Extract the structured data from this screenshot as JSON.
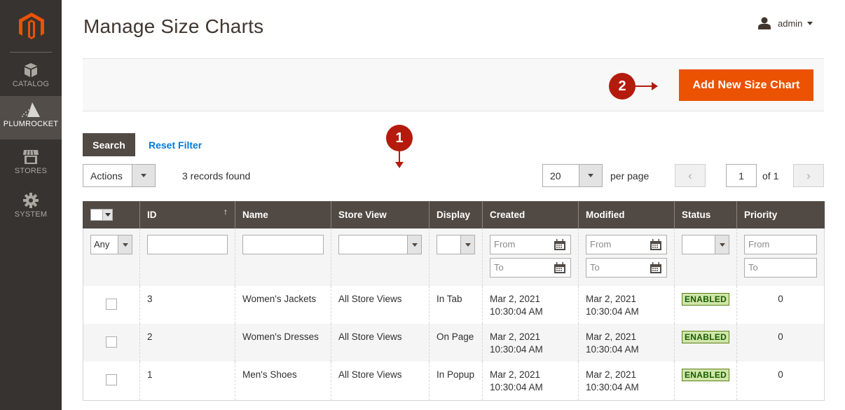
{
  "sidebar": {
    "logo": "magento-logo",
    "items": [
      {
        "label": "CATALOG",
        "icon": "box-icon",
        "active": false
      },
      {
        "label": "PLUMROCKET",
        "icon": "plumrocket-icon",
        "active": true
      },
      {
        "label": "STORES",
        "icon": "storefront-icon",
        "active": false
      },
      {
        "label": "SYSTEM",
        "icon": "gear-icon",
        "active": false
      }
    ]
  },
  "header": {
    "title": "Manage Size Charts",
    "user": "admin"
  },
  "action_bar": {
    "add_button": "Add New Size Chart"
  },
  "callouts": {
    "one": "1",
    "two": "2"
  },
  "grid_controls": {
    "search_button": "Search",
    "reset_filter": "Reset Filter",
    "actions_select": "Actions",
    "records_found": "3 records found",
    "per_page_value": "20",
    "per_page_label": "per page",
    "current_page": "1",
    "page_of": "of 1",
    "prev_icon": "‹",
    "next_icon": "›"
  },
  "columns": [
    "",
    "ID",
    "Name",
    "Store View",
    "Display",
    "Created",
    "Modified",
    "Status",
    "Priority"
  ],
  "sort_indicator": "↑",
  "filters": {
    "select_any": "Any",
    "from_placeholder": "From",
    "to_placeholder": "To"
  },
  "rows": [
    {
      "id": "3",
      "name": "Women's Jackets",
      "store_view": "All Store Views",
      "display": "In Tab",
      "created_date": "Mar 2, 2021",
      "created_time": "10:30:04 AM",
      "modified_date": "Mar 2, 2021",
      "modified_time": "10:30:04 AM",
      "status": "ENABLED",
      "priority": "0"
    },
    {
      "id": "2",
      "name": "Women's Dresses",
      "store_view": "All Store Views",
      "display": "On Page",
      "created_date": "Mar 2, 2021",
      "created_time": "10:30:04 AM",
      "modified_date": "Mar 2, 2021",
      "modified_time": "10:30:04 AM",
      "status": "ENABLED",
      "priority": "0"
    },
    {
      "id": "1",
      "name": "Men's Shoes",
      "store_view": "All Store Views",
      "display": "In Popup",
      "created_date": "Mar 2, 2021",
      "created_time": "10:30:04 AM",
      "modified_date": "Mar 2, 2021",
      "modified_time": "10:30:04 AM",
      "status": "ENABLED",
      "priority": "0"
    }
  ],
  "colors": {
    "accent": "#eb5202",
    "sidebar": "#373330",
    "header_bg": "#514943",
    "callout": "#b41b0d",
    "link": "#007bdb",
    "enabled_bg": "#d0e5a9",
    "enabled_text": "#185b00"
  }
}
